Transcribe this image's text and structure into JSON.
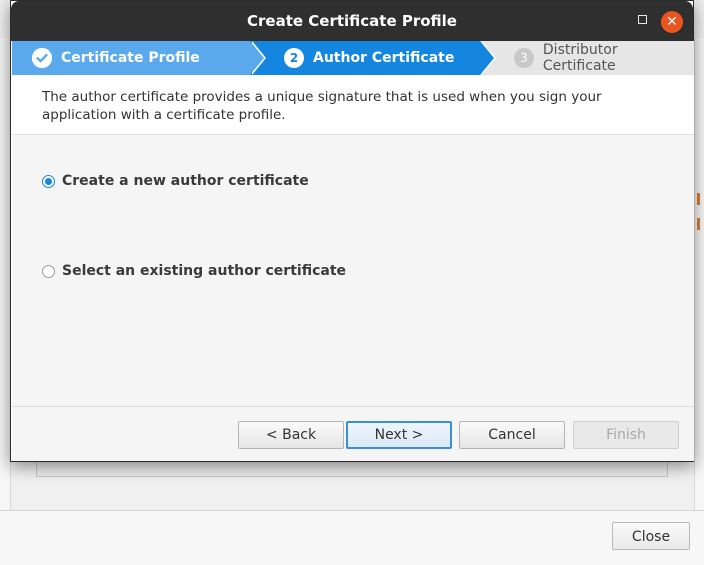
{
  "dialog": {
    "title": "Create Certificate Profile",
    "steps": [
      {
        "number": "1",
        "label": "Certificate Profile",
        "state": "completed"
      },
      {
        "number": "2",
        "label": "Author Certificate",
        "state": "active"
      },
      {
        "number": "3",
        "label": "Distributor Certificate",
        "state": "pending"
      }
    ],
    "description": "The author certificate provides a unique signature that is used when you sign your application with a certificate profile.",
    "options": [
      {
        "label": "Create a new author certificate",
        "selected": true
      },
      {
        "label": "Select an existing author certificate",
        "selected": false
      }
    ],
    "buttons": {
      "back": "< Back",
      "next": "Next >",
      "cancel": "Cancel",
      "finish": "Finish"
    }
  },
  "parent_window": {
    "close_button": "Close"
  },
  "colors": {
    "accent": "#1486e0",
    "accent_light": "#5aa9ec",
    "titlebar": "#2f2f2f",
    "close_circle": "#e95420"
  },
  "icons": {
    "step1": "checkmark-icon",
    "window_close": "close-icon",
    "window_maximize": "maximize-icon"
  }
}
